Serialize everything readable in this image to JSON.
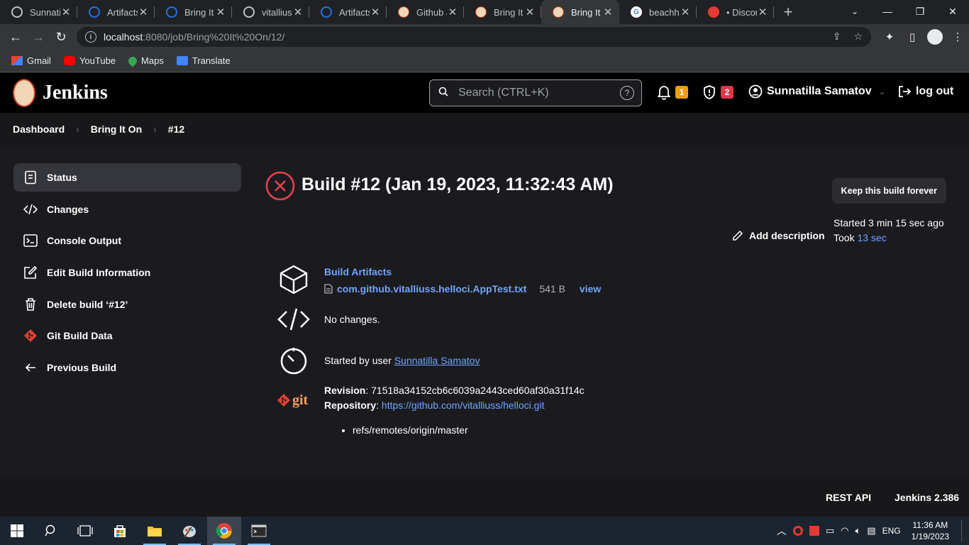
{
  "browser": {
    "tabs": [
      {
        "title": "Sunnatill",
        "icon": "github-icon",
        "active": false
      },
      {
        "title": "Artifacts",
        "icon": "ring-icon",
        "active": false
      },
      {
        "title": "Bring It O",
        "icon": "ring-icon",
        "active": false
      },
      {
        "title": "vitalliuss",
        "icon": "github-icon",
        "active": false
      },
      {
        "title": "Artifacts",
        "icon": "ring-icon",
        "active": false
      },
      {
        "title": "Github J",
        "icon": "jenkins-icon",
        "active": false
      },
      {
        "title": "Bring It O",
        "icon": "jenkins-icon",
        "active": false
      },
      {
        "title": "Bring It O",
        "icon": "jenkins-icon",
        "active": true
      },
      {
        "title": "beachhe",
        "icon": "google-icon",
        "active": false
      },
      {
        "title": "• Discon",
        "icon": "discord-icon",
        "active": false
      }
    ],
    "url_host": "localhost",
    "url_path": ":8080/job/Bring%20It%20On/12/",
    "bookmarks": [
      "Gmail",
      "YouTube",
      "Maps",
      "Translate"
    ]
  },
  "jenkins": {
    "title": "Jenkins",
    "search_placeholder": "Search (CTRL+K)",
    "notifications_count": "1",
    "security_count": "2",
    "user_name": "Sunnatilla Samatov",
    "logout_label": "log out"
  },
  "breadcrumb": [
    "Dashboard",
    "Bring It On",
    "#12"
  ],
  "sidebar": [
    {
      "label": "Status",
      "icon": "status-icon",
      "active": true
    },
    {
      "label": "Changes",
      "icon": "code-icon",
      "active": false
    },
    {
      "label": "Console Output",
      "icon": "terminal-icon",
      "active": false
    },
    {
      "label": "Edit Build Information",
      "icon": "edit-icon",
      "active": false
    },
    {
      "label": "Delete build ‘#12’",
      "icon": "trash-icon",
      "active": false
    },
    {
      "label": "Git Build Data",
      "icon": "git-icon",
      "active": false
    },
    {
      "label": "Previous Build",
      "icon": "arrow-left-icon",
      "active": false
    }
  ],
  "build": {
    "title": "Build #12 (Jan 19, 2023, 11:32:43 AM)",
    "keep_label": "Keep this build forever",
    "started_ago": "Started 3 min 15 sec ago",
    "took_prefix": "Took ",
    "took_value": "13 sec",
    "add_description": "Add description",
    "artifacts_heading": "Build Artifacts",
    "artifact_file": "com.github.vitalliuss.helloci.AppTest.txt",
    "artifact_size": "541 B",
    "artifact_view": "view",
    "changes_text": "No changes.",
    "started_by_prefix": "Started by user ",
    "started_by_user": "Sunnatilla Samatov",
    "git_logo_text": "git",
    "revision_label": "Revision",
    "revision_value": "71518a34152cb6c6039a2443ced60af30a31f14c",
    "repository_label": "Repository",
    "repository_value": "https://github.com/vitalliuss/helloci.git",
    "branch": "refs/remotes/origin/master"
  },
  "footer": {
    "rest_api": "REST API",
    "version": "Jenkins 2.386"
  },
  "taskbar": {
    "lang": "ENG",
    "time": "11:36 AM",
    "date": "1/19/2023"
  },
  "colors": {
    "link": "#6ea5ff",
    "error": "#e6424d",
    "badge_orange": "#f39c12",
    "badge_red": "#e0364c"
  }
}
